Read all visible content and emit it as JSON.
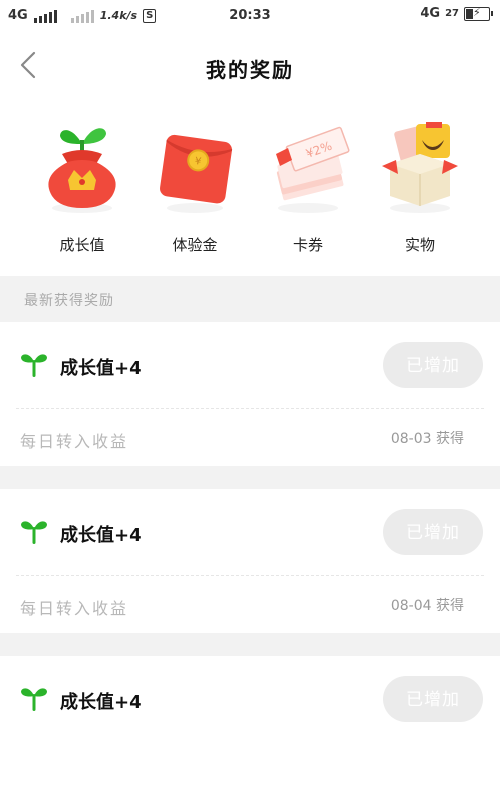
{
  "status_bar": {
    "network": "4G",
    "speed": "1.4k/s",
    "sim_badge": "S",
    "time": "20:33",
    "network_right": "4G",
    "battery": "27"
  },
  "header": {
    "title": "我的奖励",
    "back_icon": "chevron-left-icon"
  },
  "categories": [
    {
      "label": "成长值",
      "icon": "growth-bag-icon"
    },
    {
      "label": "体验金",
      "icon": "red-envelope-icon"
    },
    {
      "label": "卡券",
      "icon": "coupon-stack-icon"
    },
    {
      "label": "实物",
      "icon": "gift-box-icon"
    }
  ],
  "section_title": "最新获得奖励",
  "rewards": [
    {
      "title": "成长值+4",
      "status": "已增加",
      "source": "每日转入收益",
      "date": "08-03 获得"
    },
    {
      "title": "成长值+4",
      "status": "已增加",
      "source": "每日转入收益",
      "date": "08-04 获得"
    },
    {
      "title": "成长值+4",
      "status": "已增加"
    }
  ],
  "colors": {
    "accent_green": "#2bb32b",
    "red": "#f04a3c",
    "gold": "#f7c531",
    "button_gray": "#ebebeb"
  }
}
